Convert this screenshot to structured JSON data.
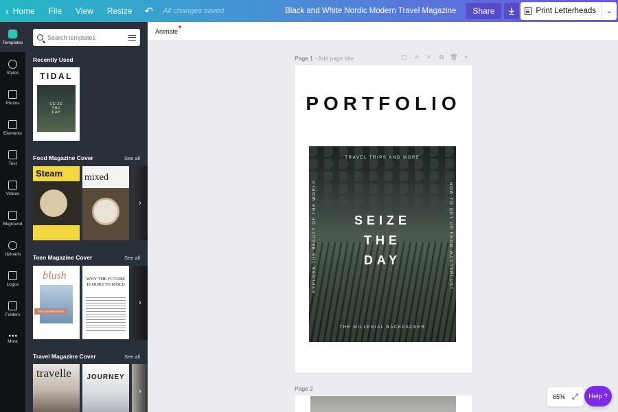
{
  "topbar": {
    "home": "Home",
    "file": "File",
    "view": "View",
    "resize": "Resize",
    "saved_status": "All changes saved",
    "doc_title": "Black and White Nordic Modern Travel Magazine",
    "share": "Share",
    "print": "Print Letterheads"
  },
  "rail": {
    "items": [
      {
        "label": "Templates",
        "icon": "templates-icon"
      },
      {
        "label": "Styles",
        "icon": "styles-icon"
      },
      {
        "label": "Photos",
        "icon": "photos-icon"
      },
      {
        "label": "Elements",
        "icon": "elements-icon"
      },
      {
        "label": "Text",
        "icon": "text-icon"
      },
      {
        "label": "Videos",
        "icon": "videos-icon"
      },
      {
        "label": "Bkground",
        "icon": "background-icon"
      },
      {
        "label": "Uploads",
        "icon": "uploads-icon"
      },
      {
        "label": "Logos",
        "icon": "logos-icon"
      },
      {
        "label": "Folders",
        "icon": "folders-icon"
      },
      {
        "label": "More",
        "icon": "more-icon"
      }
    ]
  },
  "panel": {
    "search_placeholder": "Search templates",
    "recently_used": "Recently Used",
    "see_all": "See all",
    "food": "Food Magazine Cover",
    "teen": "Teen Magazine Cover",
    "travel": "Travel Magazine Cover",
    "thumbs": {
      "tidal": "TIDAL",
      "tidal_sub": [
        "SEIZE",
        "THE",
        "DAY"
      ],
      "steam": "Steam",
      "mixed": "mixed",
      "blush": "blush",
      "blush_tag": "THE SUMMER ISSUE",
      "future": "WHY THE FUTURE IS OURS TO MOLD",
      "travelle": "travelle",
      "journey": "JOURNEY"
    }
  },
  "editor": {
    "animate": "Animate",
    "page1": "Page 1 - ",
    "page1_add": "Add page title",
    "page2": "Page 2",
    "zoom": "65%",
    "help": "Help ?"
  },
  "design": {
    "title": "PORTFOLIO",
    "top": "TRAVEL TRIPS AND MORE",
    "left_vertical": "EXPLORE THE BEAUTY OF THE WORLD",
    "right_vertical": "HOW TO GET UP FROM WANDERLUST",
    "lines": [
      "SEIZE",
      "THE",
      "DAY"
    ],
    "bottom": "THE MILLENIAL BACKPACKER"
  }
}
